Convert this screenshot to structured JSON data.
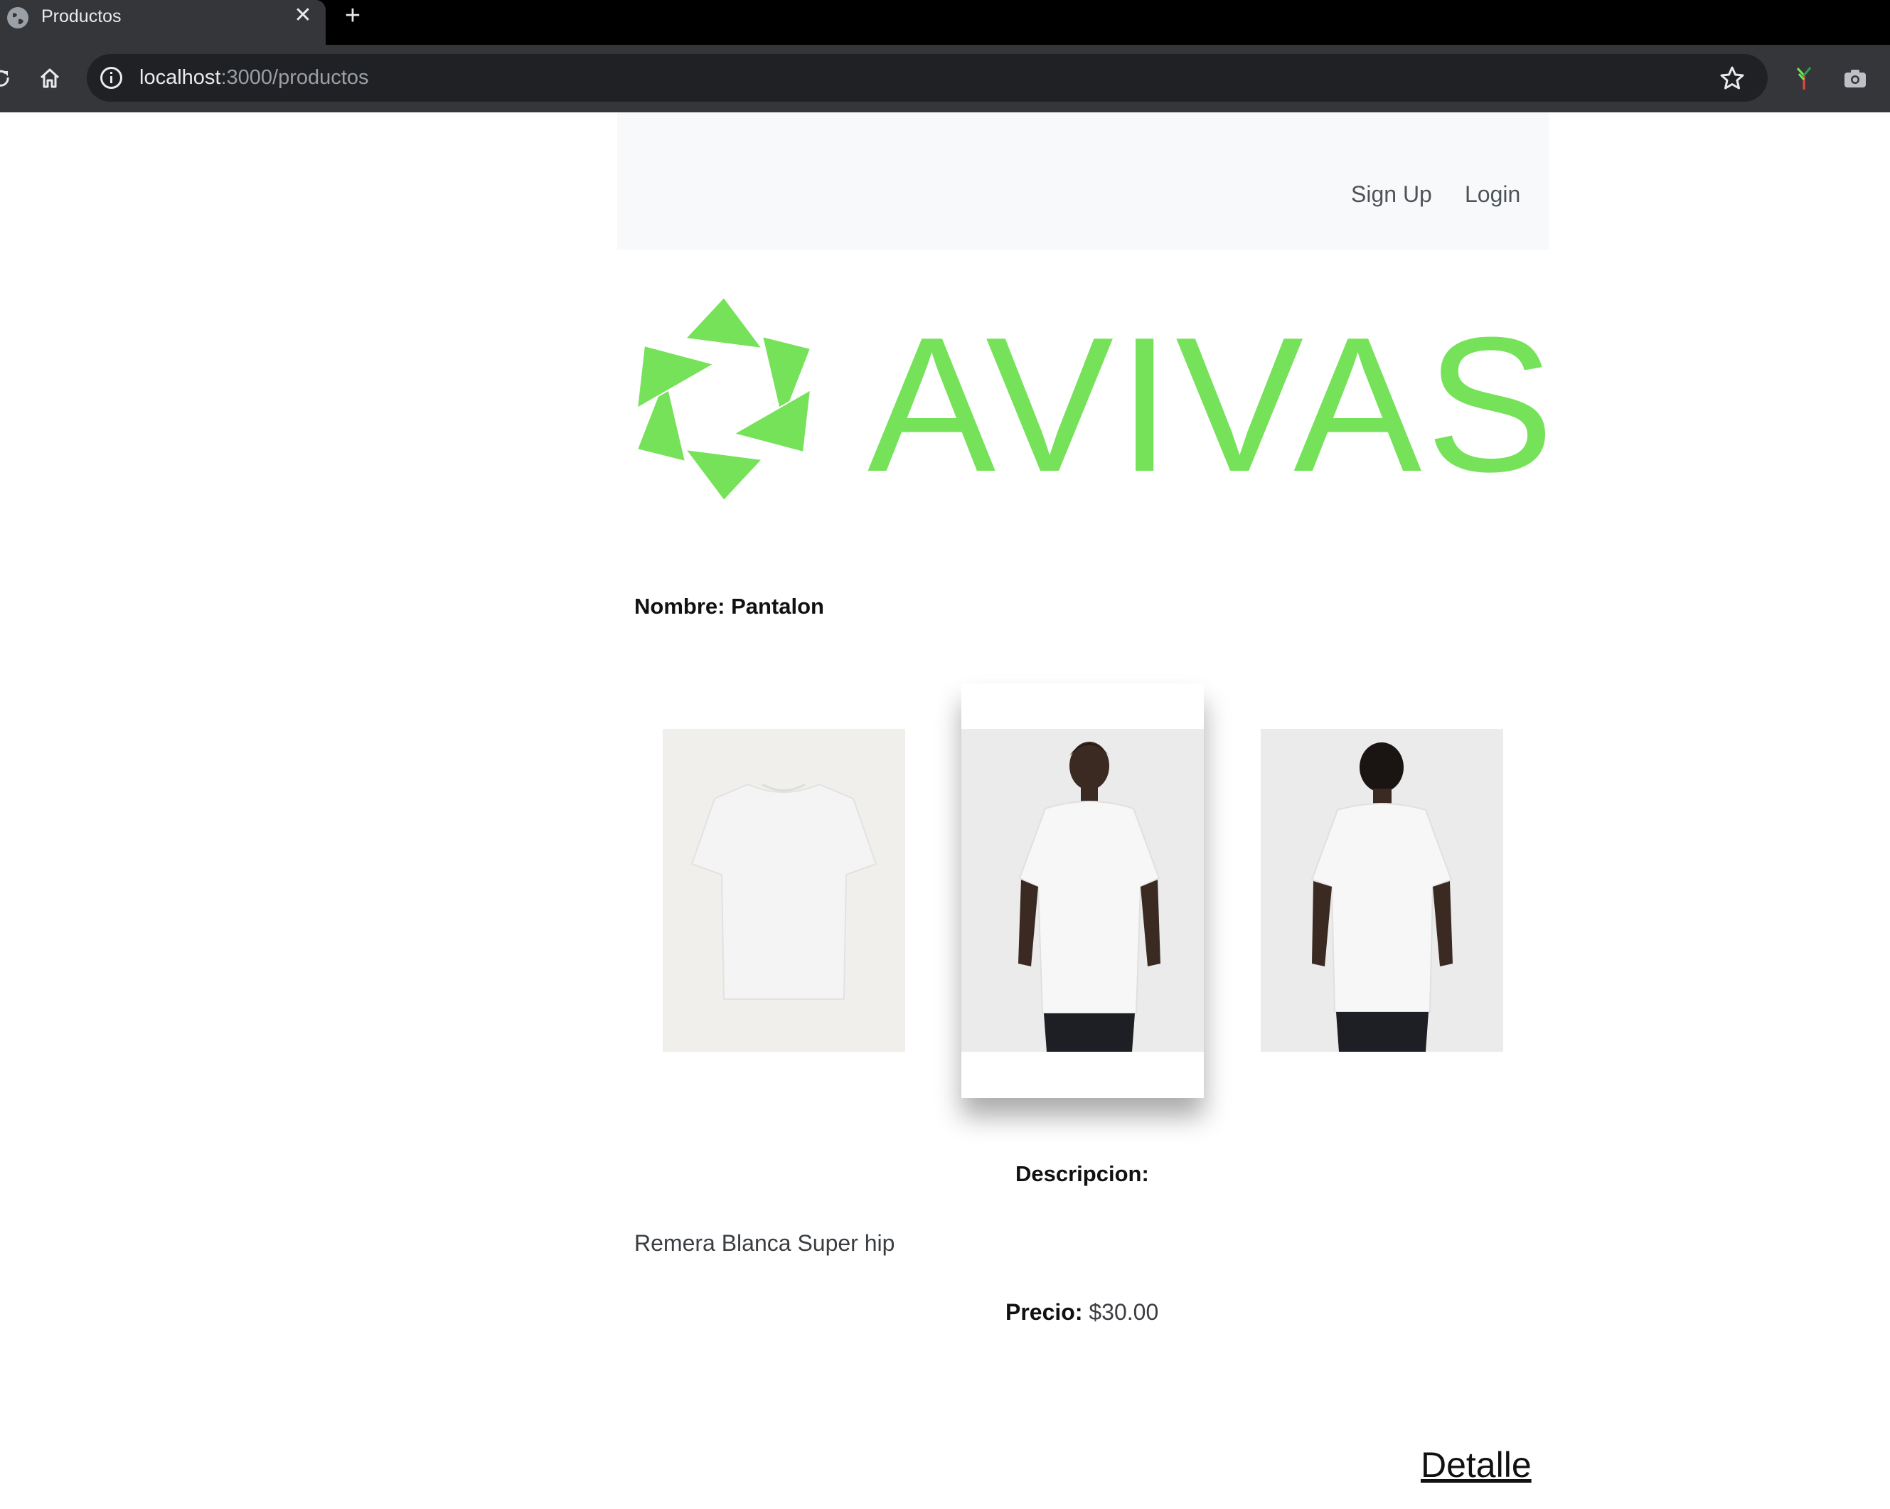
{
  "browser": {
    "tab_title": "Productos",
    "tab_close_symbol": "✕",
    "new_tab_symbol": "+",
    "url_host": "localhost",
    "url_path": ":3000/productos"
  },
  "nav": {
    "signup_label": "Sign Up",
    "login_label": "Login"
  },
  "brand": {
    "name": "AVIVAS",
    "color": "#76e25a"
  },
  "product": {
    "name_label": "Nombre: Pantalon",
    "images": [
      {
        "name": "product-image-front-flat"
      },
      {
        "name": "product-image-model-front"
      },
      {
        "name": "product-image-model-back"
      }
    ],
    "description_label": "Descripcion:",
    "description": "Remera Blanca Super hip",
    "price_label": "Precio:",
    "price_value": "$30.00",
    "detail_link": "Detalle"
  },
  "icons": {
    "favicon": "globe-icon",
    "reload": "reload-icon",
    "home": "home-icon",
    "info": "info-icon",
    "bookmark": "star-icon",
    "extension": "extension-icon",
    "screenshot": "camera-icon",
    "logo": "triangle-star-logo-icon"
  }
}
